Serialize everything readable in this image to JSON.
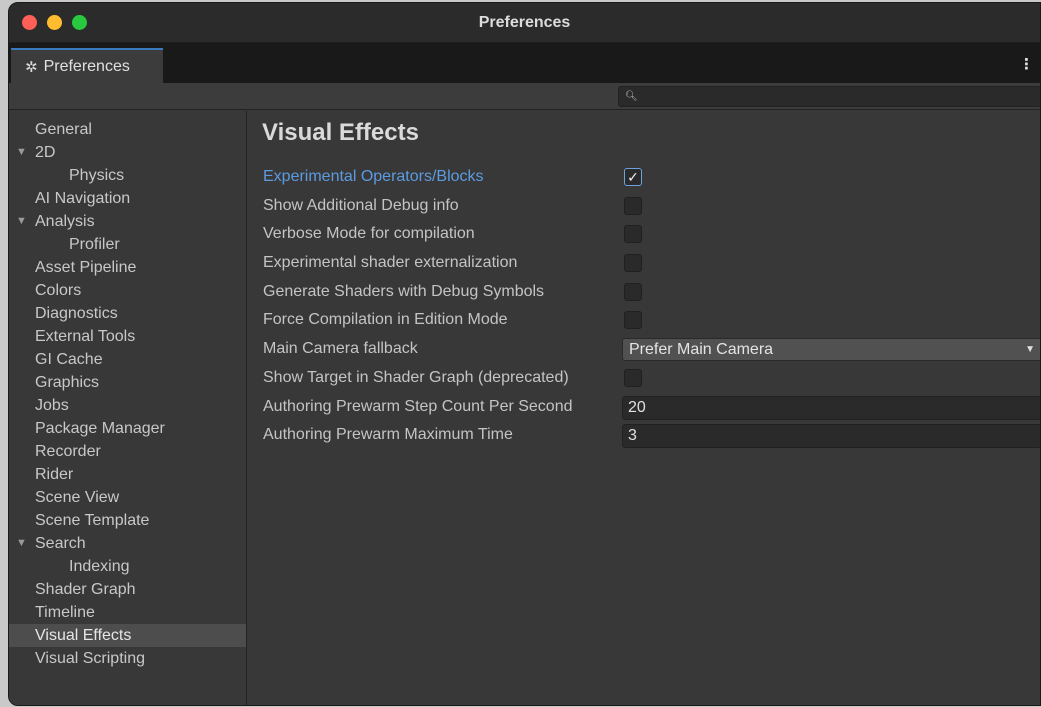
{
  "window": {
    "title": "Preferences"
  },
  "tab": {
    "label": "Preferences"
  },
  "search": {
    "placeholder": ""
  },
  "sidebar": {
    "items": [
      {
        "label": "General",
        "level": 0,
        "expandable": false,
        "selected": false
      },
      {
        "label": "2D",
        "level": 0,
        "expandable": true,
        "selected": false
      },
      {
        "label": "Physics",
        "level": 1,
        "expandable": false,
        "selected": false
      },
      {
        "label": "AI Navigation",
        "level": 0,
        "expandable": false,
        "selected": false
      },
      {
        "label": "Analysis",
        "level": 0,
        "expandable": true,
        "selected": false
      },
      {
        "label": "Profiler",
        "level": 1,
        "expandable": false,
        "selected": false
      },
      {
        "label": "Asset Pipeline",
        "level": 0,
        "expandable": false,
        "selected": false
      },
      {
        "label": "Colors",
        "level": 0,
        "expandable": false,
        "selected": false
      },
      {
        "label": "Diagnostics",
        "level": 0,
        "expandable": false,
        "selected": false
      },
      {
        "label": "External Tools",
        "level": 0,
        "expandable": false,
        "selected": false
      },
      {
        "label": "GI Cache",
        "level": 0,
        "expandable": false,
        "selected": false
      },
      {
        "label": "Graphics",
        "level": 0,
        "expandable": false,
        "selected": false
      },
      {
        "label": "Jobs",
        "level": 0,
        "expandable": false,
        "selected": false
      },
      {
        "label": "Package Manager",
        "level": 0,
        "expandable": false,
        "selected": false
      },
      {
        "label": "Recorder",
        "level": 0,
        "expandable": false,
        "selected": false
      },
      {
        "label": "Rider",
        "level": 0,
        "expandable": false,
        "selected": false
      },
      {
        "label": "Scene View",
        "level": 0,
        "expandable": false,
        "selected": false
      },
      {
        "label": "Scene Template",
        "level": 0,
        "expandable": false,
        "selected": false
      },
      {
        "label": "Search",
        "level": 0,
        "expandable": true,
        "selected": false
      },
      {
        "label": "Indexing",
        "level": 1,
        "expandable": false,
        "selected": false
      },
      {
        "label": "Shader Graph",
        "level": 0,
        "expandable": false,
        "selected": false
      },
      {
        "label": "Timeline",
        "level": 0,
        "expandable": false,
        "selected": false
      },
      {
        "label": "Visual Effects",
        "level": 0,
        "expandable": false,
        "selected": true
      },
      {
        "label": "Visual Scripting",
        "level": 0,
        "expandable": false,
        "selected": false
      }
    ]
  },
  "main": {
    "title": "Visual Effects",
    "settings": {
      "experimental_operators": {
        "label": "Experimental Operators/Blocks",
        "checked": true
      },
      "show_debug_info": {
        "label": "Show Additional Debug info",
        "checked": false
      },
      "verbose_mode": {
        "label": "Verbose Mode for compilation",
        "checked": false
      },
      "shader_externalization": {
        "label": "Experimental shader externalization",
        "checked": false
      },
      "debug_symbols": {
        "label": "Generate Shaders with Debug Symbols",
        "checked": false
      },
      "force_compilation": {
        "label": "Force Compilation in Edition Mode",
        "checked": false
      },
      "camera_fallback": {
        "label": "Main Camera fallback",
        "value": "Prefer Main Camera"
      },
      "show_target_shader_graph": {
        "label": "Show Target in Shader Graph (deprecated)",
        "checked": false
      },
      "prewarm_step_count": {
        "label": "Authoring Prewarm Step Count Per Second",
        "value": "20"
      },
      "prewarm_max_time": {
        "label": "Authoring Prewarm Maximum Time",
        "value": "3"
      }
    }
  },
  "colors": {
    "accent": "#3a79bb",
    "highlight_label": "#5c9be0",
    "panel_bg": "#383838",
    "selected_bg": "#4d4d4d"
  }
}
